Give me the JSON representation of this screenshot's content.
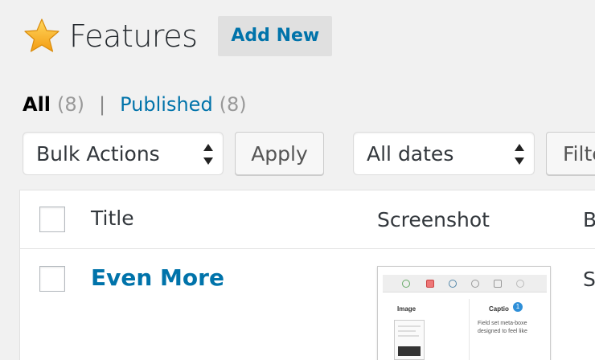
{
  "header": {
    "title": "Features",
    "add_new_label": "Add New",
    "icon": "star-icon",
    "icon_color": "#f5a623"
  },
  "filters": {
    "all_label": "All",
    "all_count": "(8)",
    "separator": "|",
    "published_label": "Published",
    "published_count": "(8)"
  },
  "tablenav": {
    "bulk_actions": "Bulk Actions",
    "apply_label": "Apply",
    "dates": "All dates",
    "filter_label": "Filte"
  },
  "table": {
    "columns": [
      "Title",
      "Screenshot",
      "B"
    ],
    "rows": [
      {
        "title": "Even More",
        "col_b": "S",
        "thumbnail": {
          "left_label": "Image",
          "right_label": "Captio",
          "badge": "1",
          "text_line_1": "Field set meta-boxe",
          "text_line_2": "designed to feel like"
        }
      }
    ]
  },
  "colors": {
    "accent": "#0073aa",
    "background": "#f1f1f1"
  }
}
